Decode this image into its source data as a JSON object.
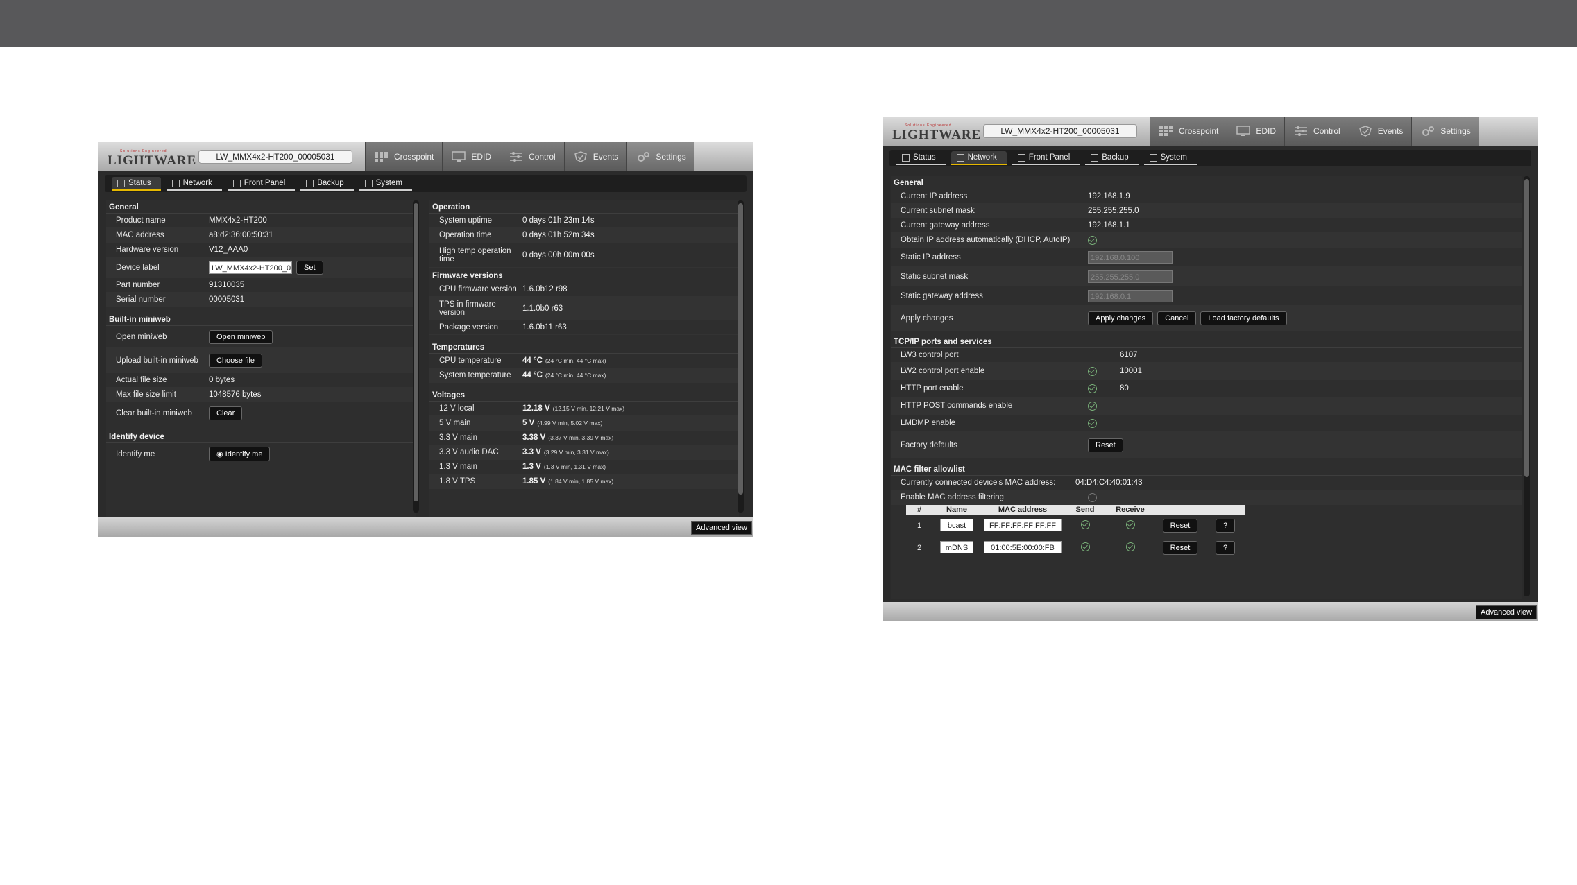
{
  "app": {
    "logo_small": "Solutions Engineered",
    "logo": "LIGHTWARE",
    "device_name": "LW_MMX4x2-HT200_00005031",
    "main_tabs": [
      "Crosspoint",
      "EDID",
      "Control",
      "Events",
      "Settings"
    ],
    "sub_tabs": [
      "Status",
      "Network",
      "Front Panel",
      "Backup",
      "System"
    ],
    "advanced_view": "Advanced view"
  },
  "status_screen": {
    "general": {
      "title": "General",
      "product_name_label": "Product name",
      "product_name": "MMX4x2-HT200",
      "mac_label": "MAC address",
      "mac": "a8:d2:36:00:50:31",
      "hw_label": "Hardware version",
      "hw": "V12_AAA0",
      "device_label_label": "Device label",
      "device_label_value": "LW_MMX4x2-HT200_0",
      "set_button": "Set",
      "part_label": "Part number",
      "part": "91310035",
      "serial_label": "Serial number",
      "serial": "00005031"
    },
    "miniweb": {
      "title": "Built-in miniweb",
      "open_label": "Open miniweb",
      "open_button": "Open miniweb",
      "upload_label": "Upload built-in miniweb",
      "choose_button": "Choose file",
      "actual_label": "Actual file size",
      "actual": "0 bytes",
      "max_label": "Max file size limit",
      "max": "1048576 bytes",
      "clear_label": "Clear built-in miniweb",
      "clear_button": "Clear"
    },
    "identify": {
      "title": "Identify device",
      "label": "Identify me",
      "button": "Identify me"
    },
    "operation": {
      "title": "Operation",
      "uptime_label": "System uptime",
      "uptime": "0 days 01h 23m 14s",
      "optime_label": "Operation time",
      "optime": "0 days 01h 52m 34s",
      "hightemp_label": "High temp operation time",
      "hightemp": "0 days 00h 00m 00s"
    },
    "firmware": {
      "title": "Firmware versions",
      "cpu_label": "CPU firmware version",
      "cpu": "1.6.0b12 r98",
      "tps_label": "TPS in firmware version",
      "tps": "1.1.0b0 r63",
      "pkg_label": "Package version",
      "pkg": "1.6.0b11 r63"
    },
    "temperatures": {
      "title": "Temperatures",
      "cpu_label": "CPU temperature",
      "cpu": "44 °C",
      "cpu_range": "(24 °C min, 44 °C max)",
      "sys_label": "System temperature",
      "sys": "44 °C",
      "sys_range": "(24 °C min, 44 °C max)"
    },
    "voltages": {
      "title": "Voltages",
      "items": [
        {
          "label": "12 V local",
          "value": "12.18 V",
          "range": "(12.15 V min, 12.21 V max)"
        },
        {
          "label": "5 V main",
          "value": "5 V",
          "range": "(4.99 V min, 5.02 V max)"
        },
        {
          "label": "3.3 V main",
          "value": "3.38 V",
          "range": "(3.37 V min, 3.39 V max)"
        },
        {
          "label": "3.3 V audio DAC",
          "value": "3.3 V",
          "range": "(3.29 V min, 3.31 V max)"
        },
        {
          "label": "1.3 V main",
          "value": "1.3 V",
          "range": "(1.3 V min, 1.31 V max)"
        },
        {
          "label": "1.8 V TPS",
          "value": "1.85 V",
          "range": "(1.84 V min, 1.85 V max)"
        }
      ]
    }
  },
  "network_screen": {
    "general": {
      "title": "General",
      "ip_label": "Current IP address",
      "ip": "192.168.1.9",
      "mask_label": "Current subnet mask",
      "mask": "255.255.255.0",
      "gw_label": "Current gateway address",
      "gw": "192.168.1.1",
      "dhcp_label": "Obtain IP address automatically (DHCP, AutoIP)",
      "sip_label": "Static IP address",
      "sip": "192.168.0.100",
      "smask_label": "Static subnet mask",
      "smask": "255.255.255.0",
      "sgw_label": "Static gateway address",
      "sgw": "192.168.0.1",
      "apply_label": "Apply changes",
      "apply_button": "Apply changes",
      "cancel_button": "Cancel",
      "factory_button": "Load factory defaults"
    },
    "tcpip": {
      "title": "TCP/IP ports and services",
      "lw3_label": "LW3 control port",
      "lw3": "6107",
      "lw2_label": "LW2 control port enable",
      "lw2": "10001",
      "http_label": "HTTP port enable",
      "http": "80",
      "post_label": "HTTP POST commands enable",
      "lmdmp_label": "LMDMP enable",
      "factory_label": "Factory defaults",
      "reset_button": "Reset"
    },
    "mac_filter": {
      "title": "MAC filter allowlist",
      "connected_label": "Currently connected device's MAC address:",
      "connected": "04:D4:C4:40:01:43",
      "enable_label": "Enable MAC address filtering",
      "columns": [
        "#",
        "Name",
        "MAC address",
        "Send",
        "Receive"
      ],
      "rows": [
        {
          "n": "1",
          "name": "bcast",
          "mac": "FF:FF:FF:FF:FF:FF",
          "reset": "Reset",
          "help": "?"
        },
        {
          "n": "2",
          "name": "mDNS",
          "mac": "01:00:5E:00:00:FB",
          "reset": "Reset",
          "help": "?"
        }
      ]
    }
  }
}
